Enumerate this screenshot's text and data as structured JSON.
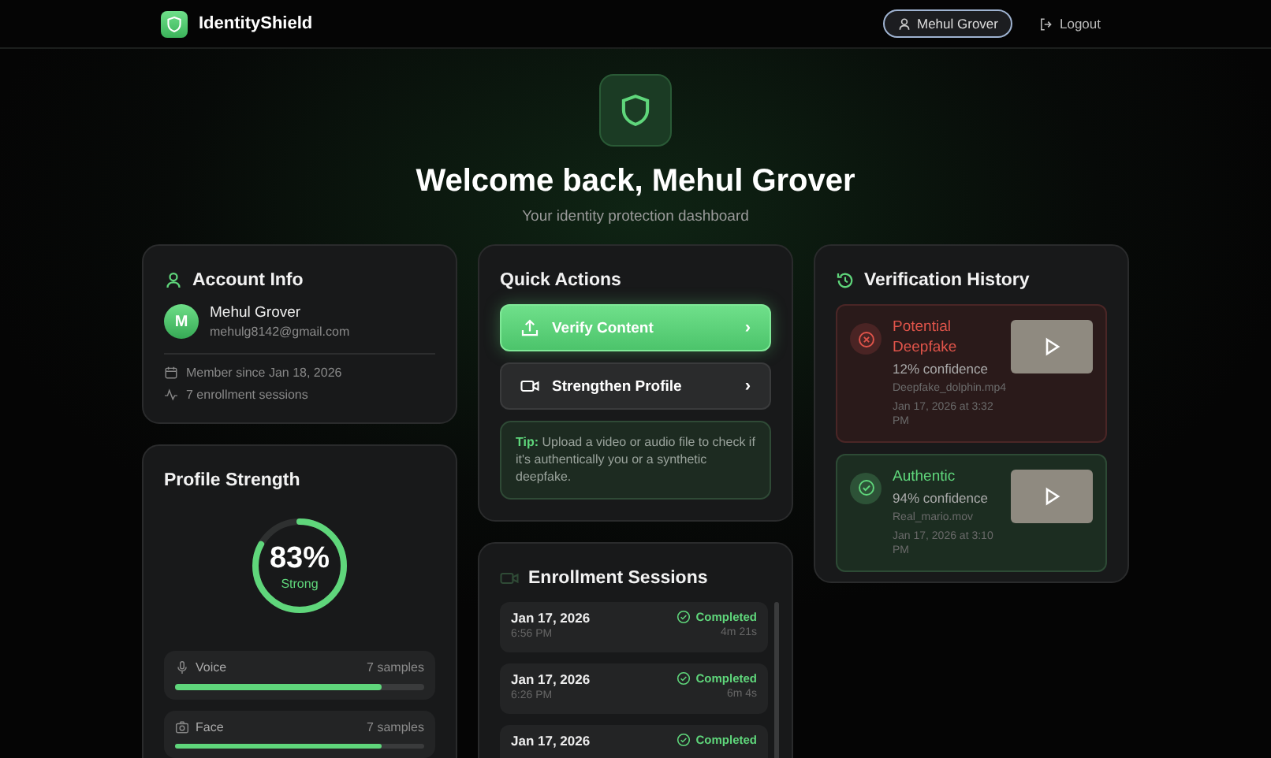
{
  "header": {
    "brand": "IdentityShield",
    "user_button": "Mehul Grover",
    "logout": "Logout"
  },
  "hero": {
    "title": "Welcome back, Mehul Grover",
    "subtitle": "Your identity protection dashboard"
  },
  "account": {
    "title": "Account Info",
    "avatar_initial": "M",
    "name": "Mehul Grover",
    "email": "mehulg8142@gmail.com",
    "member_since": "Member since Jan 18, 2026",
    "sessions": "7 enrollment sessions"
  },
  "profile_strength": {
    "title": "Profile Strength",
    "percent": "83%",
    "rating": "Strong",
    "level": 0.83,
    "modalities": [
      {
        "kind": "voice",
        "label": "Voice",
        "samples": "7 samples",
        "level": 0.83
      },
      {
        "kind": "face",
        "label": "Face",
        "samples": "7 samples",
        "level": 0.83
      }
    ]
  },
  "quick_actions": {
    "title": "Quick Actions",
    "actions": [
      {
        "kind": "primary",
        "label": "Verify Content",
        "chevron": "›"
      },
      {
        "kind": "secondary",
        "label": "Strengthen Profile",
        "chevron": "›"
      }
    ],
    "tip": "**Tip:** Upload a video or audio file to check if it's authentically you or a synthetic deepfake."
  },
  "enrollment": {
    "title": "Enrollment Sessions",
    "sessions": [
      {
        "date": "Jan 17, 2026",
        "time": "6:56 PM",
        "status": "Completed",
        "duration": "4m 21s"
      },
      {
        "date": "Jan 17, 2026",
        "time": "6:26 PM",
        "status": "Completed",
        "duration": "6m 4s"
      },
      {
        "date": "Jan 17, 2026",
        "status": "Completed"
      }
    ]
  },
  "history": {
    "title": "Verification History",
    "items": [
      {
        "kind": "deepfake",
        "verdict": "Potential Deepfake",
        "confidence": "12% confidence",
        "file": "Deepfake_dolphin.mp4",
        "date": "Jan 17, 2026 at 3:32 PM"
      },
      {
        "kind": "authentic",
        "verdict": "Authentic",
        "confidence": "94% confidence",
        "file": "Real_mario.mov",
        "date": "Jan 17, 2026 at 3:10 PM"
      }
    ]
  }
}
